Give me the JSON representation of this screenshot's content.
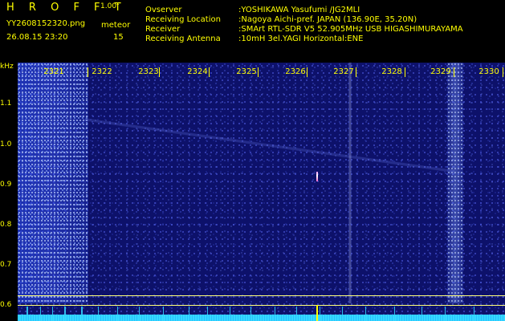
{
  "header": {
    "app_name": "H R O F F T",
    "version": "1.00f",
    "filename": "YY2608152320.png",
    "meteor_label": "meteor",
    "meteor_count": "15",
    "timestamp": "26.08.15 23:20"
  },
  "meta": {
    "observer_label": "Ovserver",
    "observer_value": ":YOSHIKAWA Yasufumi /JG2MLI",
    "location_label": "Receiving Location",
    "location_value": ":Nagoya Aichi-pref. JAPAN (136.90E, 35.20N)",
    "receiver_label": "Receiver",
    "receiver_value": ":SMArt RTL-SDR V5 52.905MHz USB HIGASHIMURAYAMA",
    "antenna_label": "Receiving Antenna",
    "antenna_value": ":10mH 3el.YAGI Horizontal:ENE"
  },
  "axes": {
    "unit_label": "kHz",
    "y_ticks": [
      "1.1",
      "1.0",
      "0.9",
      "0.8",
      "0.7",
      "0.6"
    ],
    "x_ticks": [
      "2321",
      "2322",
      "2323",
      "2324",
      "2325",
      "2326",
      "2327",
      "2328",
      "2329",
      "2330"
    ]
  },
  "colors": {
    "text": "#ffff00",
    "background": "#000000",
    "plot_base": "#0d116a",
    "baseline": "#35d9ff"
  }
}
